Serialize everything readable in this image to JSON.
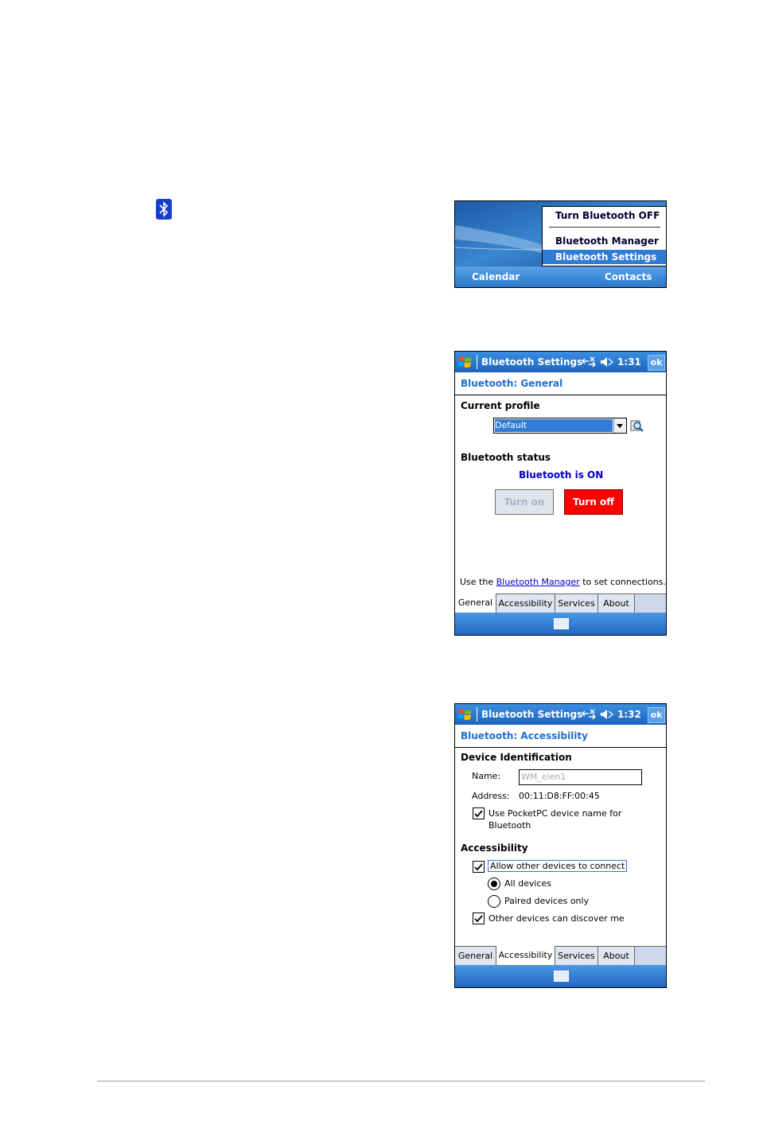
{
  "menu": {
    "items": [
      "Turn Bluetooth OFF",
      "Bluetooth Manager",
      "Bluetooth Settings"
    ],
    "selected_index": 2,
    "softkey_left": "Calendar",
    "softkey_right": "Contacts"
  },
  "general": {
    "title": "Bluetooth Settings",
    "time": "1:31",
    "ok_label": "ok",
    "subheading": "Bluetooth: General",
    "current_profile_label": "Current profile",
    "profile_value": "Default",
    "status_label": "Bluetooth status",
    "status_value": "Bluetooth is ON",
    "turn_on_label": "Turn on",
    "turn_off_label": "Turn off",
    "footer_prefix": "Use the",
    "footer_link": "Bluetooth Manager",
    "footer_suffix": "to set connections.",
    "tabs": [
      "General",
      "Accessibility",
      "Services",
      "About"
    ],
    "active_tab": 0
  },
  "accessibility": {
    "title": "Bluetooth Settings",
    "time": "1:32",
    "ok_label": "ok",
    "subheading": "Bluetooth: Accessibility",
    "device_id_label": "Device Identification",
    "name_label": "Name:",
    "name_value": "WM_elen1",
    "address_label": "Address:",
    "address_value": "00:11:D8:FF:00:45",
    "use_name_line1": "Use PocketPC device name for",
    "use_name_line2": "Bluetooth",
    "use_name_checked": true,
    "access_label": "Accessibility",
    "allow_label": "Allow other devices to connect",
    "allow_checked": true,
    "all_devices_label": "All devices",
    "paired_label": "Paired devices only",
    "radio_selected": "all",
    "discover_label": "Other devices can discover me",
    "discover_checked": true,
    "tabs": [
      "General",
      "Accessibility",
      "Services",
      "About"
    ],
    "active_tab": 1
  },
  "colors": {
    "accent_blue": "#1e6fd0",
    "turn_off_red": "#ff0000",
    "status_blue": "#0000cc"
  },
  "icons": [
    "bluetooth-icon",
    "windows-flag-icon",
    "connectivity-icon",
    "speaker-icon",
    "magnifier-icon",
    "keyboard-icon",
    "checkmark-icon"
  ]
}
